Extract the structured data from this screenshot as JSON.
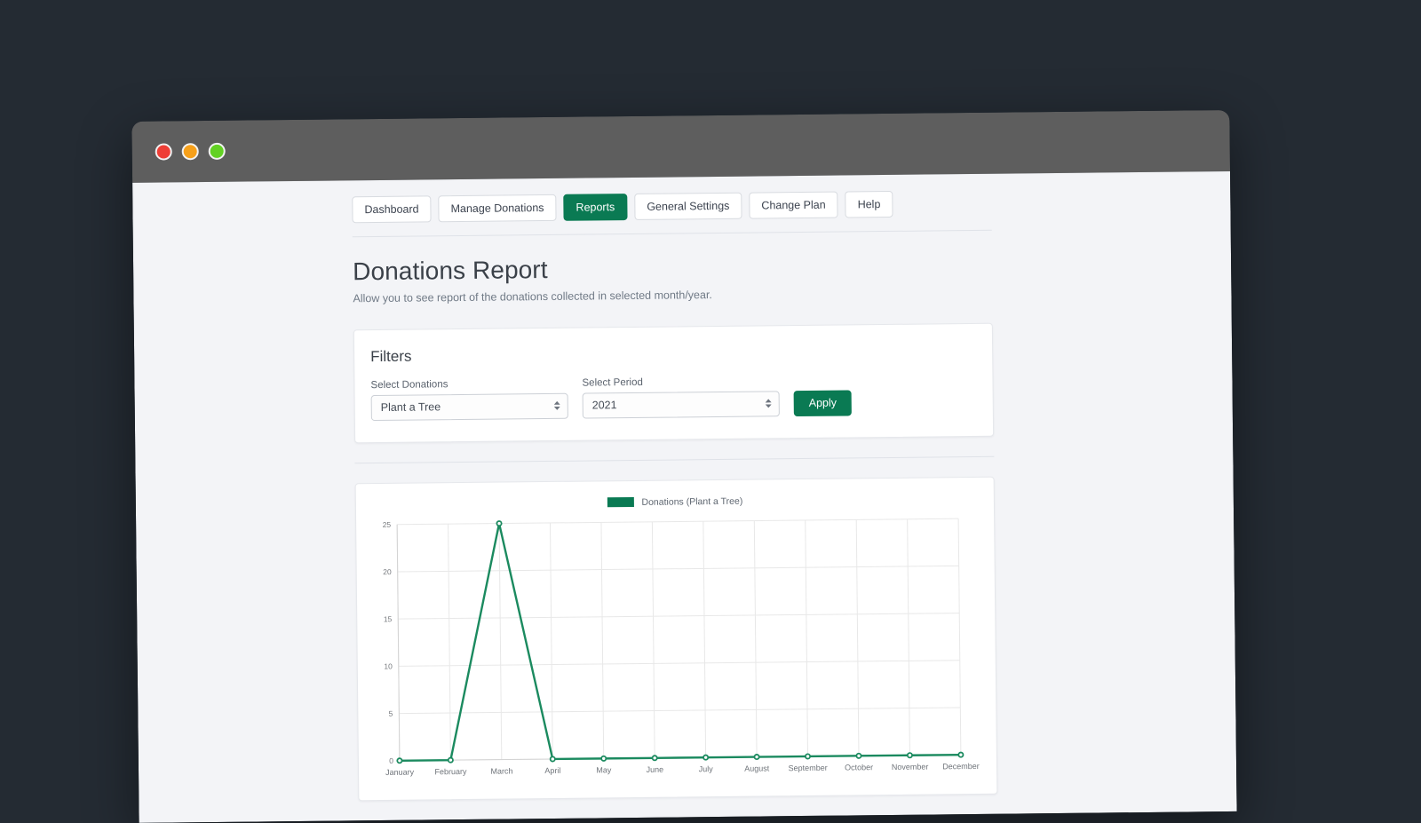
{
  "window": {
    "traffic_lights": [
      "close",
      "minimize",
      "maximize"
    ]
  },
  "nav": {
    "tabs": [
      {
        "label": "Dashboard",
        "active": false
      },
      {
        "label": "Manage Donations",
        "active": false
      },
      {
        "label": "Reports",
        "active": true
      },
      {
        "label": "General Settings",
        "active": false
      },
      {
        "label": "Change Plan",
        "active": false
      },
      {
        "label": "Help",
        "active": false
      }
    ]
  },
  "heading": {
    "title": "Donations Report",
    "subtitle": "Allow you to see report of the donations collected in selected month/year."
  },
  "filters": {
    "title": "Filters",
    "donations": {
      "label": "Select Donations",
      "value": "Plant a Tree",
      "options": [
        "Plant a Tree"
      ]
    },
    "period": {
      "label": "Select Period",
      "value": "2021",
      "options": [
        "2021"
      ]
    },
    "apply_label": "Apply"
  },
  "colors": {
    "accent_green": "#0a7a53",
    "line_green": "#1b8a5f",
    "page_background": "#f3f4f7",
    "titlebar": "#5e5e5e",
    "backdrop": "#242b33",
    "traffic_red": "#ee3e36",
    "traffic_yellow": "#f6a01a",
    "traffic_green": "#62d123"
  },
  "chart_data": {
    "type": "line",
    "title": "",
    "legend": [
      "Donations (Plant a Tree)"
    ],
    "legend_position": "top-center",
    "grid": true,
    "xlabel": "",
    "ylabel": "",
    "categories": [
      "January",
      "February",
      "March",
      "April",
      "May",
      "June",
      "July",
      "August",
      "September",
      "October",
      "November",
      "December"
    ],
    "values": [
      0,
      0,
      25,
      0,
      0,
      0,
      0,
      0,
      0,
      0,
      0,
      0
    ],
    "yticks": [
      0,
      5,
      10,
      15,
      20,
      25
    ],
    "ylim": [
      0,
      25
    ],
    "series": [
      {
        "name": "Donations (Plant a Tree)",
        "color": "#1b8a5f",
        "values": [
          0,
          0,
          25,
          0,
          0,
          0,
          0,
          0,
          0,
          0,
          0,
          0
        ]
      }
    ]
  }
}
